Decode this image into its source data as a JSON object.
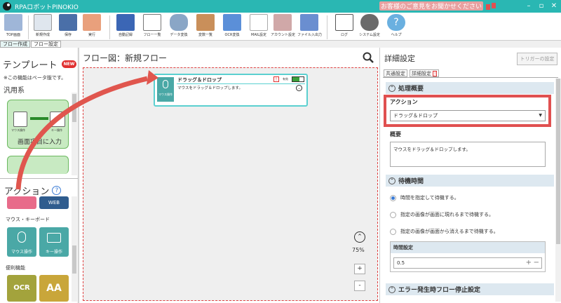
{
  "app": {
    "title": "RPAロボットPINOKIO",
    "feedback": "お客様のご意見をお聞かせください"
  },
  "toolbar": {
    "items": [
      {
        "label": "TOP画面",
        "color": "#9fb6d8"
      },
      {
        "label": "新規作成",
        "color": "#dfe6ee"
      },
      {
        "label": "保存",
        "color": "#4a6fa8"
      },
      {
        "label": "実行",
        "color": "#e9a07c"
      },
      {
        "label": "自動記録",
        "color": "#3b66b5"
      },
      {
        "label": "フロー一覧",
        "color": "#7a7a7a"
      },
      {
        "label": "データ変換",
        "color": "#8aa6c6"
      },
      {
        "label": "変数一覧",
        "color": "#c98f5a"
      },
      {
        "label": "OCR変換",
        "color": "#5b8fd8"
      },
      {
        "label": "MAIL設定",
        "color": "#e05b5b"
      },
      {
        "label": "アカウント設定",
        "color": "#d0a8a8"
      },
      {
        "label": "ファイル入出力",
        "color": "#6a8ed0"
      },
      {
        "label": "ログ",
        "color": "#5a5a5a"
      },
      {
        "label": "システム設定",
        "color": "#6a6a6a"
      },
      {
        "label": "ヘルプ",
        "color": "#6ab0e0"
      }
    ]
  },
  "tabs": [
    "フロー作成",
    "フロー設定"
  ],
  "left": {
    "template_title": "テンプレート",
    "new_badge": "NEW",
    "beta_note": "※この機能はベータ版です。",
    "general": "汎用系",
    "template_card": "画面項目に入力",
    "card_mouse": "マウス操作",
    "card_key": "キー操作",
    "action_title": "アクション",
    "web_label": "WEB",
    "mouse_keyboard": "マウス・キーボード",
    "mouse_tile": "マウス操作",
    "key_tile": "キー操作",
    "convenient": "便利機能",
    "ocr_tile": "OCR",
    "aa_tile": "AA"
  },
  "center": {
    "flow_title": "フロー図：新規フロー",
    "node": {
      "title": "ドラッグ＆ドロップ",
      "desc": "マウスをドラッグ＆ドロップします。",
      "icon_label": "マウス操作",
      "valid": "有効"
    },
    "zoom": "75%",
    "plus": "+",
    "minus": "-"
  },
  "right": {
    "title": "詳細設定",
    "trigger_btn": "トリガーの設定",
    "tab_common": "共通設定",
    "tab_detail": "詳細設定",
    "sec_process": "処理概要",
    "action_label": "アクション",
    "action_value": "ドラッグ＆ドロップ",
    "summary_label": "概要",
    "summary_value": "マウスをドラッグ＆ドロップします。",
    "sec_wait": "待機時間",
    "radio1": "時間を指定して待機する。",
    "radio2": "指定の画像が画面に現れるまで待機する。",
    "radio3": "指定の画像が画面から消えるまで待機する。",
    "time_label": "時間設定",
    "time_value": "0.5",
    "sec_error": "エラー発生時フロー停止設定"
  }
}
